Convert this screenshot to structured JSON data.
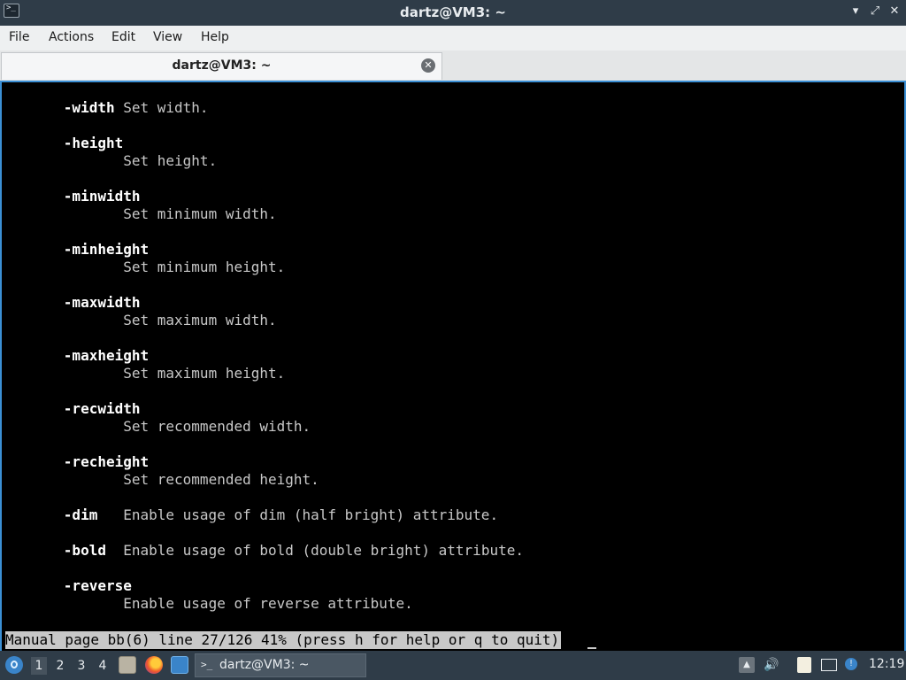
{
  "window": {
    "title": "dartz@VM3: ~",
    "controls": [
      "minimize",
      "maximize",
      "close"
    ]
  },
  "menubar": {
    "items": [
      "File",
      "Actions",
      "Edit",
      "View",
      "Help"
    ]
  },
  "tabs": [
    {
      "label": "dartz@VM3: ~",
      "active": true
    }
  ],
  "terminal": {
    "lines": [
      {
        "opt": "-width",
        "inline": " Set width.",
        "desc": ""
      },
      {
        "opt": "-height",
        "inline": "",
        "desc": "Set height."
      },
      {
        "opt": "-minwidth",
        "inline": "",
        "desc": "Set minimum width."
      },
      {
        "opt": "-minheight",
        "inline": "",
        "desc": "Set minimum height."
      },
      {
        "opt": "-maxwidth",
        "inline": "",
        "desc": "Set maximum width."
      },
      {
        "opt": "-maxheight",
        "inline": "",
        "desc": "Set maximum height."
      },
      {
        "opt": "-recwidth",
        "inline": "",
        "desc": "Set recommended width."
      },
      {
        "opt": "-recheight",
        "inline": "",
        "desc": "Set recommended height."
      },
      {
        "opt": "-dim",
        "inline": "   Enable usage of dim (half bright) attribute.",
        "desc": ""
      },
      {
        "opt": "-bold",
        "inline": "  Enable usage of bold (double bright) attribute.",
        "desc": ""
      },
      {
        "opt": "-reverse",
        "inline": "",
        "desc": "Enable usage of reverse attribute."
      }
    ],
    "status": "Manual page bb(6) line 27/126 41% (press h for help or q to quit)"
  },
  "taskbar": {
    "workspaces": [
      "1",
      "2",
      "3",
      "4"
    ],
    "active_workspace": "1",
    "launchers": [
      "file-manager-icon",
      "firefox-icon",
      "desktop-icon"
    ],
    "task": {
      "label": "dartz@VM3: ~",
      "icon": "terminal-icon"
    },
    "tray_icons": [
      "update-icon",
      "volume-icon",
      "clipboard-icon",
      "network-icon"
    ],
    "clock": "12:19"
  },
  "colors": {
    "titlebar_bg": "#2f3c48",
    "terminal_bg": "#000000",
    "terminal_fg": "#c8c8c8",
    "accent": "#3b8fd4"
  }
}
